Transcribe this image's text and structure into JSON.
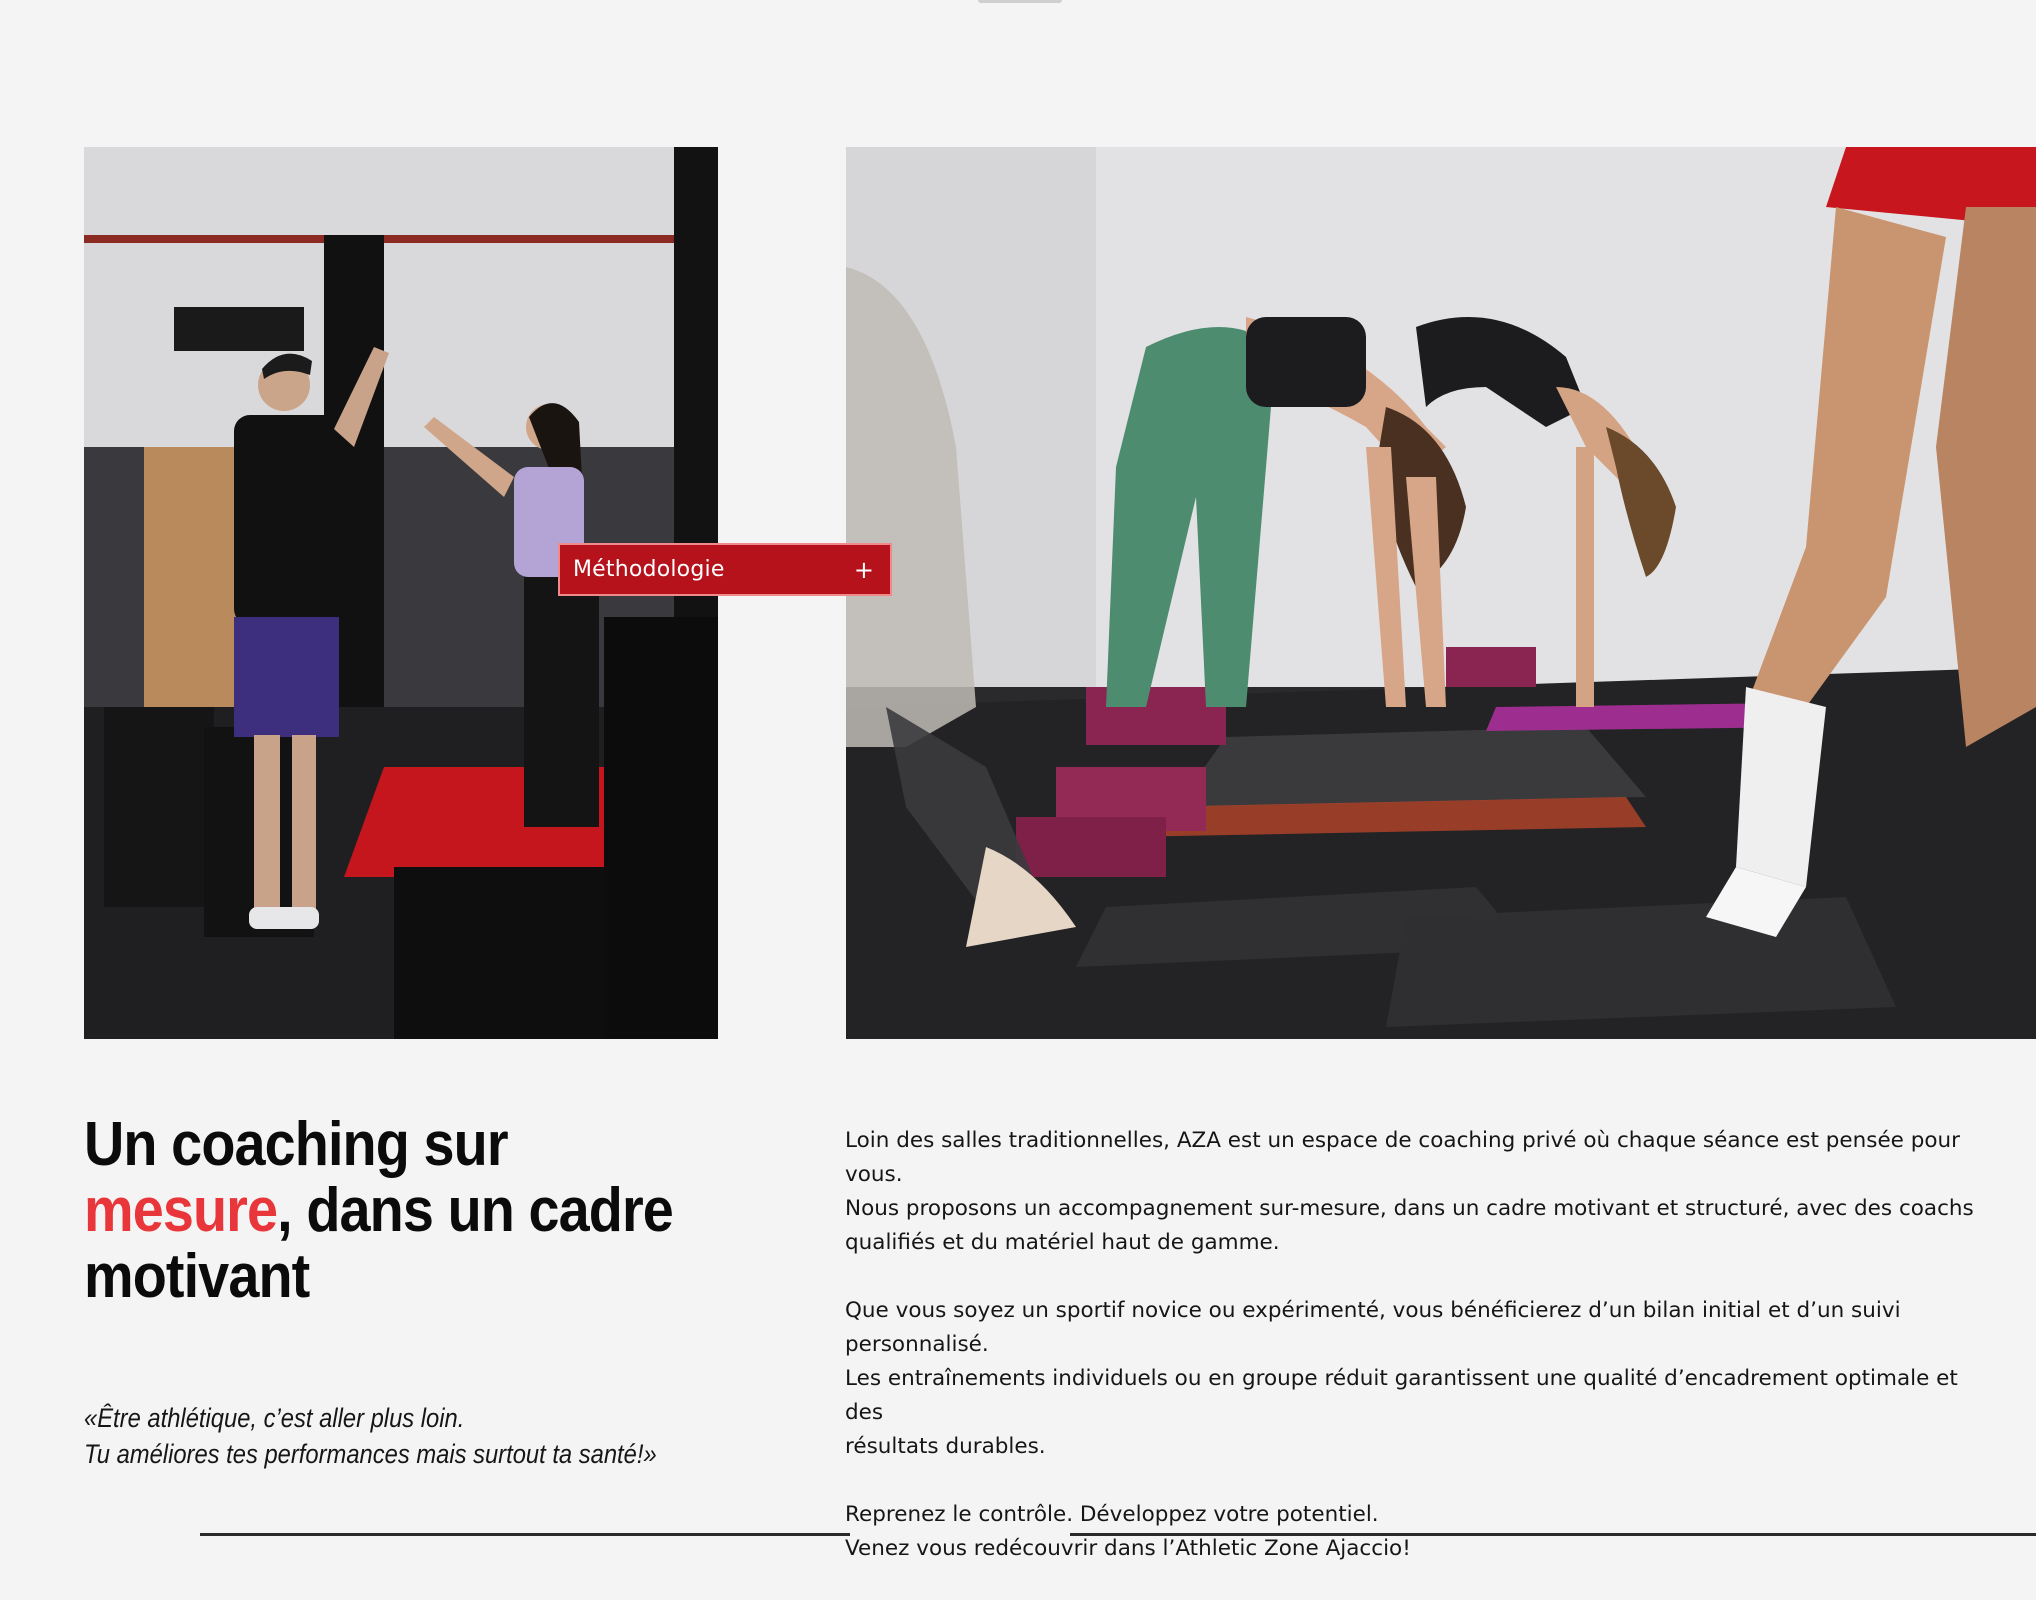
{
  "method_button": {
    "label": "Méthodologie",
    "icon": "plus-icon",
    "icon_glyph": "+"
  },
  "headline": {
    "line1": "Un coaching sur",
    "accent": "mesure",
    "line2_rest": ", dans un cadre",
    "line3": "motivant",
    "accent_color": "#e8363b"
  },
  "quote": {
    "line1": "«Être athlétique, c’est aller plus loin.",
    "line2": "Tu améliores tes performances mais surtout ta santé!»"
  },
  "body": {
    "p1": [
      "Loin des salles traditionnelles, AZA est un espace de coaching privé où chaque séance est pensée pour vous.",
      "Nous proposons un accompagnement sur-mesure, dans un cadre motivant et structuré, avec des coachs",
      "qualifiés et du matériel haut de gamme."
    ],
    "p2": [
      "Que vous soyez un sportif novice ou expérimenté, vous bénéficierez d’un bilan initial et d’un suivi personnalisé.",
      "Les entraînements individuels ou en groupe réduit garantissent une qualité d’encadrement optimale et des",
      "résultats durables."
    ],
    "p3": [
      "Reprenez le contrôle. Développez votre potentiel.",
      "Venez vous redécouvrir dans l’Athletic Zone Ajaccio!"
    ]
  },
  "colors": {
    "background": "#f4f4f4",
    "brand_red": "#b5121b",
    "accent_red": "#e8363b"
  }
}
